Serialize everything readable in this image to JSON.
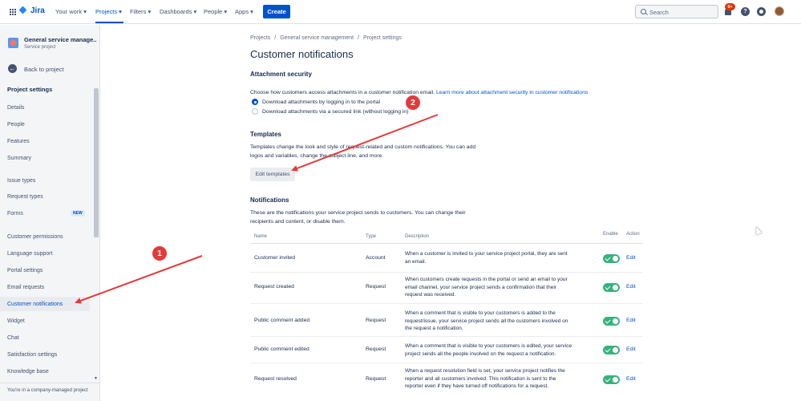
{
  "topnav": {
    "logo": "Jira",
    "items": [
      {
        "label": "Your work ▾"
      },
      {
        "label": "Projects ▾"
      },
      {
        "label": "Filters ▾"
      },
      {
        "label": "Dashboards ▾"
      },
      {
        "label": "People ▾"
      },
      {
        "label": "Apps ▾"
      }
    ],
    "create_label": "Create",
    "search_placeholder": "Search",
    "notification_badge": "9+",
    "help_label": "?"
  },
  "sidebar": {
    "project_name": "General service manage...",
    "project_type": "Service project",
    "back_label": "Back to project",
    "heading": "Project settings",
    "items": [
      {
        "label": "Details"
      },
      {
        "label": "People"
      },
      {
        "label": "Features"
      },
      {
        "label": "Summary"
      },
      {
        "label": "Issue types"
      },
      {
        "label": "Request types"
      },
      {
        "label": "Forms",
        "badge": "NEW"
      },
      {
        "label": "Customer permissions"
      },
      {
        "label": "Language support"
      },
      {
        "label": "Portal settings"
      },
      {
        "label": "Email requests"
      },
      {
        "label": "Customer notifications"
      },
      {
        "label": "Widget"
      },
      {
        "label": "Chat"
      },
      {
        "label": "Satisfaction settings"
      },
      {
        "label": "Knowledge base"
      }
    ],
    "footer": "You're in a company-managed project"
  },
  "main": {
    "breadcrumb": [
      "Projects",
      "General service management",
      "Project settings"
    ],
    "title": "Customer notifications",
    "attachment": {
      "title": "Attachment security",
      "text": "Choose how customers access attachments in a customer notification email. ",
      "link": "Learn more about attachment security in customer notifications",
      "options": [
        {
          "label": "Download attachments by logging in to the portal",
          "checked": true
        },
        {
          "label": "Download attachments via a secured link (without logging in)",
          "checked": false
        }
      ]
    },
    "templates": {
      "title": "Templates",
      "text_line1": "Templates change the look and style of request-related and custom notifications. You can add",
      "text_line2": "logos and variables, change the subject line, and more.",
      "button": "Edit templates"
    },
    "notifications": {
      "title": "Notifications",
      "text_line1": "These are the notifications your service project sends to customers. You can change their",
      "text_line2": "recipients and content, or disable them.",
      "columns": {
        "name": "Name",
        "type": "Type",
        "description": "Description",
        "enable": "Enable",
        "action": "Action"
      },
      "rows": [
        {
          "name": "Customer invited",
          "type": "Account",
          "desc": [
            "When a customer is invited to your service project portal, they are sent",
            "an email."
          ],
          "action": "Edit"
        },
        {
          "name": "Request created",
          "type": "Request",
          "desc": [
            "When customers create requests in the portal or send an email to your",
            "email channel, your service project sends a confirmation that their",
            "request was received."
          ],
          "action": "Edit"
        },
        {
          "name": "Public comment added",
          "type": "Request",
          "desc": [
            "When a comment that is visible to your customers is added to the",
            "request/issue, your service project sends all the customers involved on",
            "the request a notification."
          ],
          "action": "Edit"
        },
        {
          "name": "Public comment edited",
          "type": "Request",
          "desc": [
            "When a comment that is visible to your customers is edited, your service",
            "project sends all the people involved on the request a notification."
          ],
          "action": "Edit"
        },
        {
          "name": "Request resolved",
          "type": "Request",
          "desc": [
            "When a request resolution field is set, your service project notifies the",
            "reporter and all customers involved. This notification is sent to the",
            "reporter even if they have turned off notifications for a request."
          ],
          "action": "Edit"
        }
      ]
    }
  },
  "annotations": {
    "one": "1",
    "two": "2",
    "color": "#e03c3c"
  }
}
